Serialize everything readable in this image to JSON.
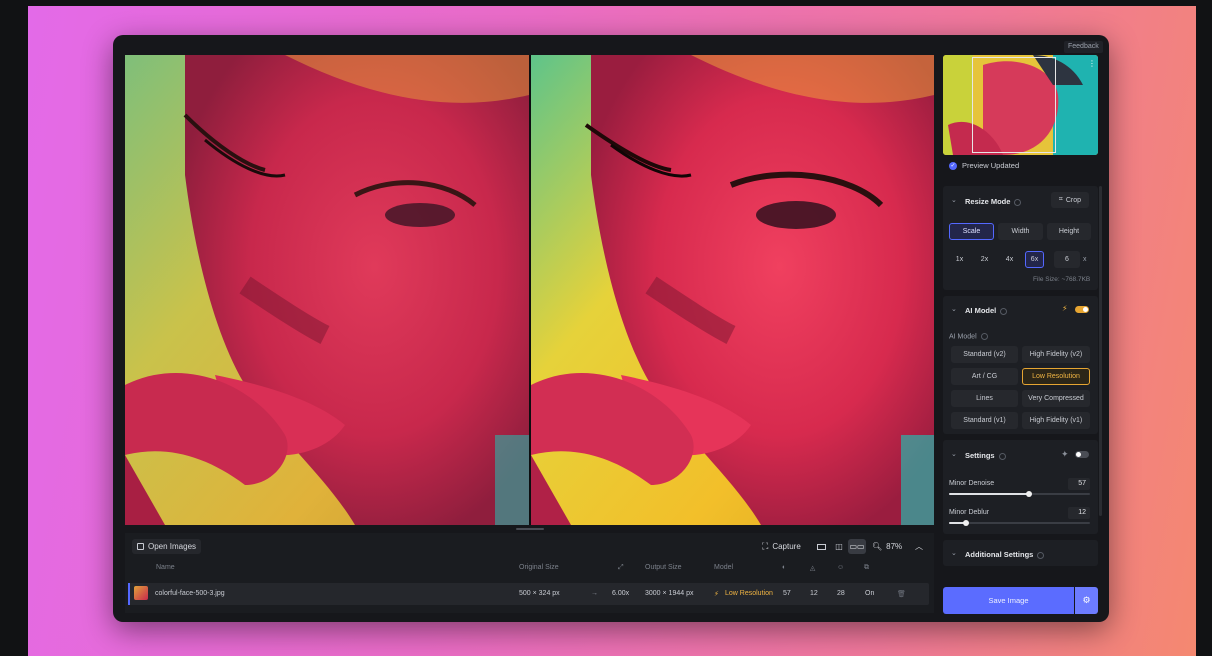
{
  "feedback_label": "Feedback",
  "preview": {
    "status": "Preview Updated"
  },
  "bottom": {
    "open_images": "Open Images",
    "capture": "Capture",
    "zoom": "87%",
    "columns": {
      "name": "Name",
      "original_size": "Original Size",
      "output_size": "Output Size",
      "model": "Model"
    },
    "row": {
      "filename": "colorful-face-500-3.jpg",
      "original_size": "500 × 324 px",
      "scale": "6.00x",
      "output_size": "3000 × 1944 px",
      "model": "Low Resolution",
      "v1": "57",
      "v2": "12",
      "v3": "28",
      "v4": "On"
    }
  },
  "resize": {
    "title": "Resize Mode",
    "crop": "Crop",
    "modes": [
      "Scale",
      "Width",
      "Height"
    ],
    "factors": [
      "1x",
      "2x",
      "4x",
      "6x"
    ],
    "custom_value": "6",
    "custom_unit": "x",
    "file_size": "File Size: ~768.7KB"
  },
  "ai_model": {
    "title": "AI Model",
    "label": "AI Model",
    "options": [
      "Standard (v2)",
      "High Fidelity (v2)",
      "Art / CG",
      "Low Resolution",
      "Lines",
      "Very Compressed",
      "Standard (v1)",
      "High Fidelity (v1)"
    ],
    "selected": "Low Resolution",
    "enabled": true
  },
  "settings": {
    "title": "Settings",
    "enabled": false,
    "minor_denoise": {
      "label": "Minor Denoise",
      "value": "57",
      "fraction": 0.57
    },
    "minor_deblur": {
      "label": "Minor Deblur",
      "value": "12",
      "fraction": 0.12
    }
  },
  "additional": {
    "title": "Additional Settings"
  },
  "save_label": "Save Image",
  "colors": {
    "accent": "#5468ff",
    "gold": "#e6a532",
    "panel": "#1d1f24"
  }
}
